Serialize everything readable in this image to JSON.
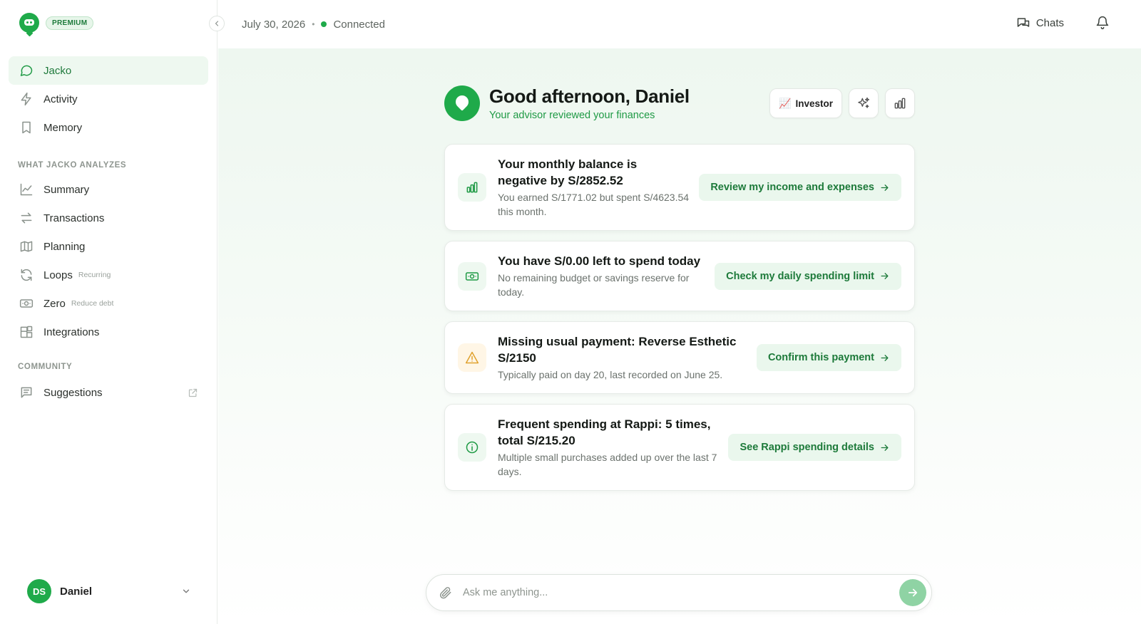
{
  "app": {
    "badge": "PREMIUM"
  },
  "sidebar": {
    "primary": [
      {
        "label": "Jacko",
        "icon": "chat-bubble-icon",
        "active": true
      },
      {
        "label": "Activity",
        "icon": "lightning-icon"
      },
      {
        "label": "Memory",
        "icon": "bookmark-icon"
      }
    ],
    "section_analyzes": "WHAT JACKO ANALYZES",
    "analyzes": [
      {
        "label": "Summary",
        "icon": "line-chart-icon"
      },
      {
        "label": "Transactions",
        "icon": "swap-arrows-icon"
      },
      {
        "label": "Planning",
        "icon": "map-icon"
      },
      {
        "label": "Loops",
        "sub": "Recurring",
        "icon": "refresh-icon"
      },
      {
        "label": "Zero",
        "sub": "Reduce debt",
        "icon": "banknote-icon"
      },
      {
        "label": "Integrations",
        "icon": "blocks-icon"
      }
    ],
    "section_community": "COMMUNITY",
    "community": [
      {
        "label": "Suggestions",
        "icon": "message-square-icon",
        "external": true
      }
    ],
    "user": {
      "initials": "DS",
      "name": "Daniel"
    }
  },
  "topbar": {
    "date": "July 30, 2026",
    "separator": "•",
    "status": "Connected",
    "chats_label": "Chats"
  },
  "greeting": {
    "title": "Good afternoon, Daniel",
    "subtitle": "Your advisor reviewed your finances",
    "investor_label": "Investor",
    "investor_emoji": "📈"
  },
  "cards": [
    {
      "title": "Your monthly balance is negative by S/2852.52",
      "desc": "You earned S/1771.02 but spent S/4623.54 this month.",
      "action": "Review my income and expenses",
      "icon": "bar-chart-icon",
      "tone": "green"
    },
    {
      "title": "You have S/0.00 left to spend today",
      "desc": "No remaining budget or savings reserve for today.",
      "action": "Check my daily spending limit",
      "icon": "banknote-icon",
      "tone": "green"
    },
    {
      "title": "Missing usual payment: Reverse Esthetic S/2150",
      "desc": "Typically paid on day 20, last recorded on June 25.",
      "action": "Confirm this payment",
      "icon": "warning-triangle-icon",
      "tone": "warn"
    },
    {
      "title": "Frequent spending at Rappi: 5 times, total S/215.20",
      "desc": "Multiple small purchases added up over the last 7 days.",
      "action": "See Rappi spending details",
      "icon": "info-circle-icon",
      "tone": "green"
    }
  ],
  "composer": {
    "placeholder": "Ask me anything..."
  },
  "colors": {
    "accent": "#1faa4a",
    "accent_text": "#1d7a3a",
    "accent_bg": "#eaf7ed",
    "warn": "#e0a12d"
  }
}
